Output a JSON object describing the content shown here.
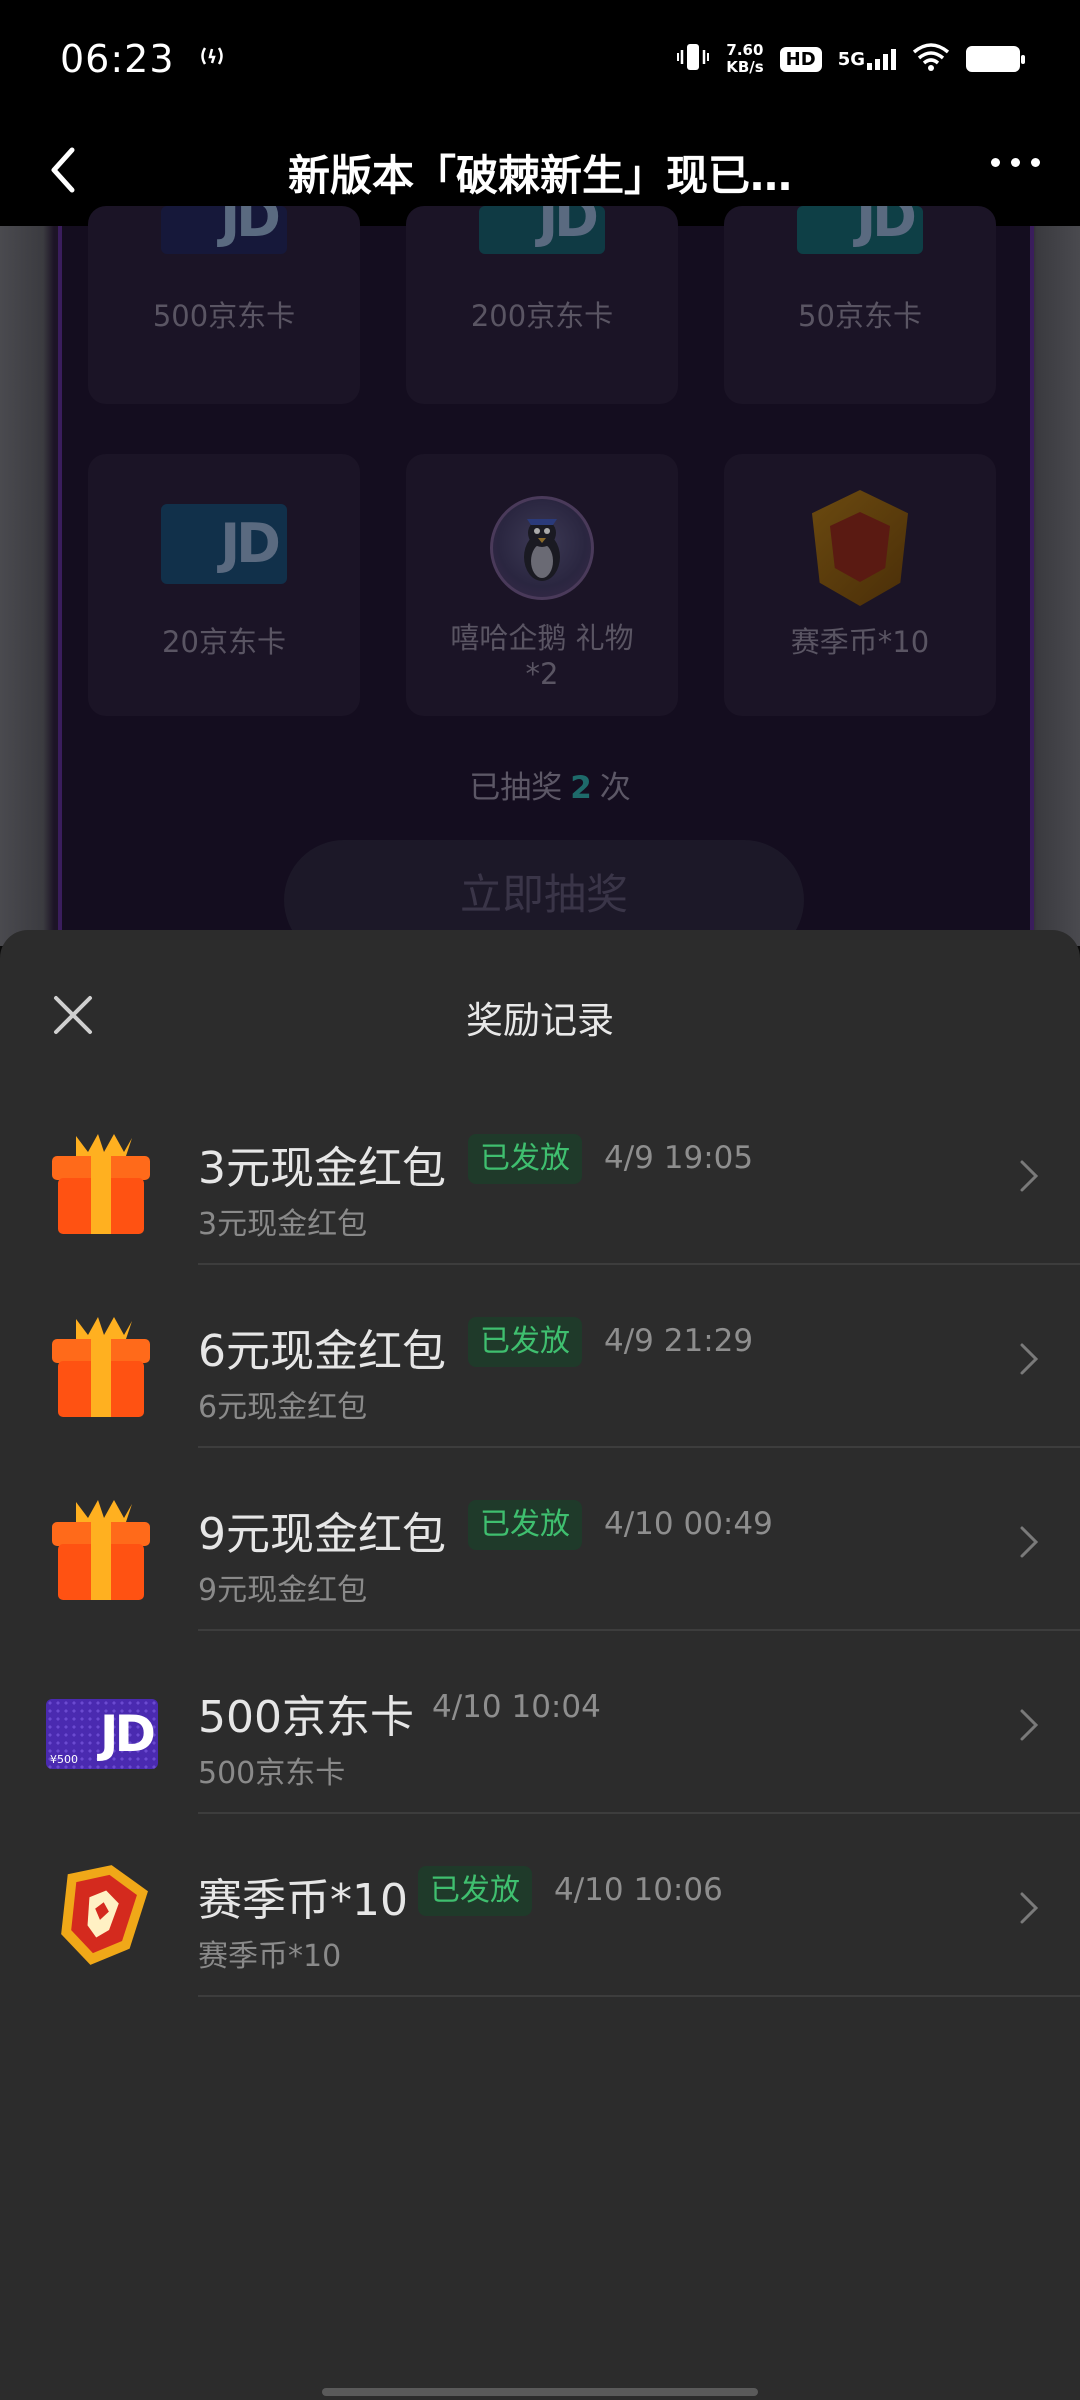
{
  "status_bar": {
    "time": "06:23",
    "net_speed_value": "7.60",
    "net_speed_unit": "KB/s",
    "hd_label": "HD",
    "network_label": "5G"
  },
  "nav": {
    "title": "新版本「破棘新生」现已…"
  },
  "background_page": {
    "prizes": [
      {
        "label": "500京东卡",
        "icon": "jd-card-icon"
      },
      {
        "label": "200京东卡",
        "icon": "jd-card-icon"
      },
      {
        "label": "50京东卡",
        "icon": "jd-card-icon"
      },
      {
        "label": "20京东卡",
        "icon": "jd-card-icon"
      },
      {
        "label": "嘻哈企鹅 礼物",
        "label_line2": "*2",
        "icon": "penguin-icon"
      },
      {
        "label": "赛季币*10",
        "icon": "season-coin-icon"
      }
    ],
    "draw_count_prefix": "已抽奖",
    "draw_count_value": "2",
    "draw_count_suffix": "次",
    "draw_button": "立即抽奖"
  },
  "sheet": {
    "title": "奖励记录",
    "records": [
      {
        "title": "3元现金红包",
        "badge": "已发放",
        "time": "4/9 19:05",
        "subtitle": "3元现金红包",
        "icon": "gift-box-icon"
      },
      {
        "title": "6元现金红包",
        "badge": "已发放",
        "time": "4/9 21:29",
        "subtitle": "6元现金红包",
        "icon": "gift-box-icon"
      },
      {
        "title": "9元现金红包",
        "badge": "已发放",
        "time": "4/10 00:49",
        "subtitle": "9元现金红包",
        "icon": "gift-box-icon"
      },
      {
        "title": "500京东卡",
        "badge": "",
        "time": "4/10 10:04",
        "subtitle": "500京东卡",
        "icon": "jd-card-icon",
        "card_value": "¥500"
      },
      {
        "title": "赛季币*10",
        "badge": "已发放",
        "time": "4/10 10:06",
        "subtitle": "赛季币*10",
        "icon": "season-coin-icon"
      }
    ]
  },
  "colors": {
    "sheet_bg": "#2c2c2c",
    "badge_bg": "#1f3a2a",
    "badge_text": "#3fbf6f",
    "draw_count_accent": "#1e6a6a"
  }
}
